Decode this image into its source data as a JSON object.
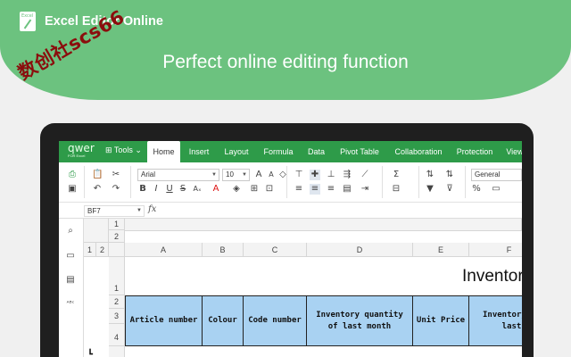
{
  "banner": {
    "app_title": "Excel Editor Online",
    "logo_text": "Excel",
    "tagline": "Perfect online editing function",
    "watermark": "数创社scs66"
  },
  "menubar": {
    "brand_top": "qwer",
    "brand_bottom": "FOR Excel",
    "tools": "Tools",
    "tabs": [
      {
        "label": "Home",
        "active": true
      },
      {
        "label": "Insert"
      },
      {
        "label": "Layout"
      },
      {
        "label": "Formula"
      },
      {
        "label": "Data"
      },
      {
        "label": "Pivot Table"
      },
      {
        "label": "Collaboration"
      },
      {
        "label": "Protection"
      },
      {
        "label": "View"
      }
    ]
  },
  "ribbon": {
    "font_name": "Arial",
    "font_size": "10",
    "number_format": "General"
  },
  "formula_bar": {
    "name_box": "BF7",
    "fx": "fx",
    "value": ""
  },
  "sheet": {
    "group_levels_top": [
      "1",
      "2"
    ],
    "group_levels_left": [
      "1",
      "2"
    ],
    "columns": [
      "A",
      "B",
      "C",
      "D",
      "E",
      "F"
    ],
    "rows": [
      "1",
      "2",
      "3",
      "4"
    ],
    "title": "Inventory",
    "headers": [
      "Article number",
      "Colour",
      "Code number",
      "Inventory quantity of last month",
      "Unit Price",
      "Inventory of last"
    ]
  },
  "colors": {
    "banner": "#6cc27f",
    "menubar": "#2e9b49",
    "header_fill": "#a9d2f2",
    "watermark": "#8b0d0d"
  }
}
